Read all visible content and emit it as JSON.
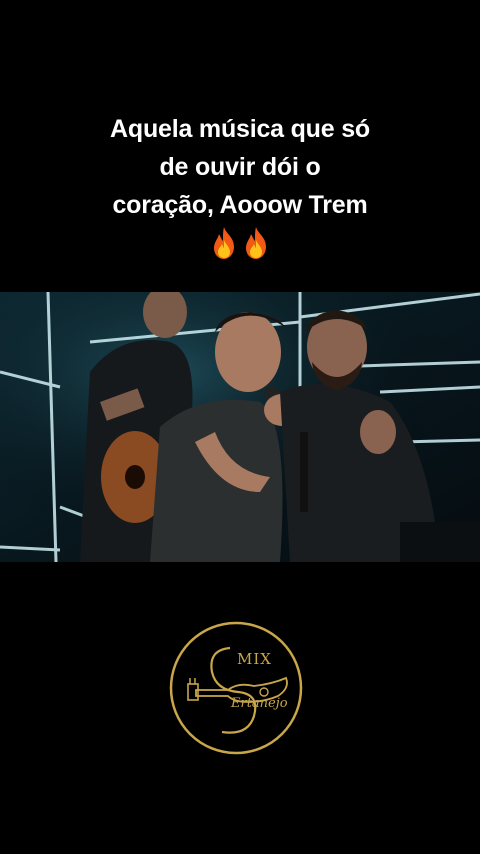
{
  "caption": {
    "lines": [
      "Aquela música que só",
      "de ouvir dói o",
      "coração, Aooow Trem"
    ]
  },
  "emoji": {
    "icon": "fire-icon",
    "count": 2
  },
  "video": {
    "description_icon": "video-frame"
  },
  "logo": {
    "top_text": "MIX",
    "bottom_text": "Ertanejo",
    "ring_color": "#c9a64a"
  },
  "colors": {
    "background": "#000000",
    "caption": "#ffffff",
    "gold": "#c9a64a"
  }
}
